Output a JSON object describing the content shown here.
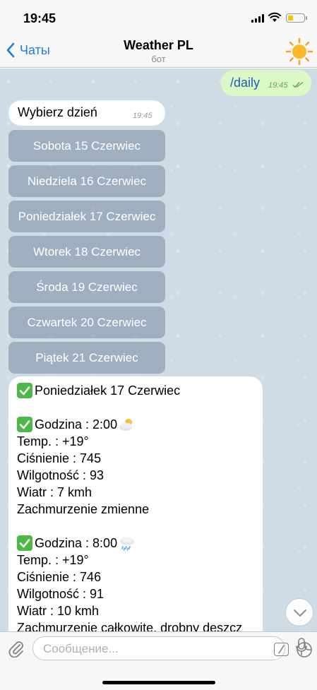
{
  "status_bar": {
    "time": "19:45"
  },
  "nav": {
    "back_label": "Чаты",
    "title": "Weather PL",
    "subtitle": "бот"
  },
  "messages": {
    "outgoing": {
      "text": "/daily",
      "time": "19:45"
    },
    "incoming": {
      "text": "Wybierz dzień",
      "time": "19:45"
    }
  },
  "keyboard": [
    "Sobota 15 Czerwiec",
    "Niedziela 16 Czerwiec",
    "Poniedziałek 17 Czerwiec",
    "Wtorek 18 Czerwiec",
    "Środa 19 Czerwiec",
    "Czwartek 20 Czerwiec",
    "Piątek 21 Czerwiec"
  ],
  "forecast": {
    "day": "Poniedziałek 17 Czerwiec",
    "entries": [
      {
        "hour": "Godzina : 2:00",
        "weather_icon": "partly-cloudy-icon",
        "temp": "Temp. : +19°",
        "pressure": "Ciśnienie : 745",
        "humidity": "Wilgotność : 93",
        "wind": "Wiatr : 7 kmh",
        "clouds": "Zachmurzenie zmienne"
      },
      {
        "hour": "Godzina : 8:00",
        "weather_icon": "rain-cloud-icon",
        "temp": "Temp. : +19°",
        "pressure": "Ciśnienie : 746",
        "humidity": "Wilgotność : 91",
        "wind": "Wiatr : 10 kmh",
        "clouds": "Zachmurzenie całkowite, drobny deszcz"
      }
    ]
  },
  "input": {
    "placeholder": "Сообщение..."
  },
  "colors": {
    "accent": "#1a7fe0",
    "outgoing_bubble": "#dcf8c6",
    "check_green": "#4cb848",
    "chat_bg": "#cfdce6"
  }
}
